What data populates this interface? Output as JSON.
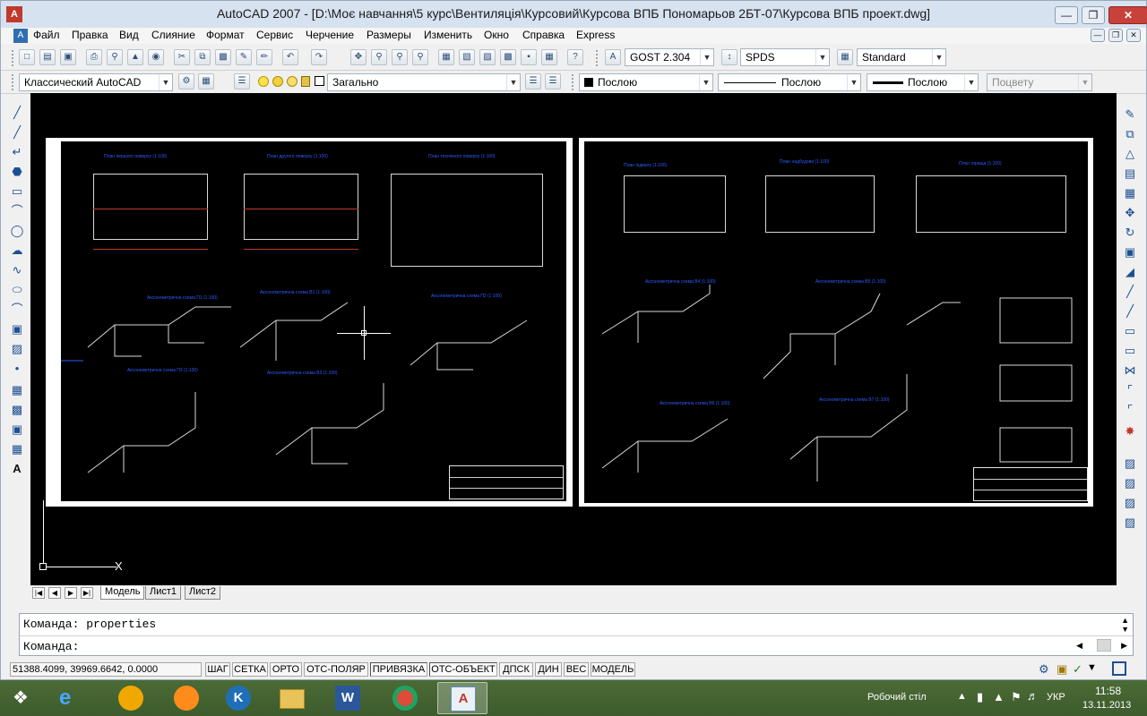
{
  "window": {
    "title": "AutoCAD 2007 - [D:\\Моє навчання\\5 курс\\Вентиляція\\Курсовий\\Курсова ВПБ Пономарьов 2БТ-07\\Курсова ВПБ проект.dwg]",
    "minimize_icon": "minimize-icon",
    "maximize_icon": "maximize-icon",
    "close_icon": "close-icon"
  },
  "menu": {
    "items": [
      "Файл",
      "Правка",
      "Вид",
      "Слияние",
      "Формат",
      "Сервис",
      "Черчение",
      "Размеры",
      "Изменить",
      "Окно",
      "Справка",
      "Express"
    ]
  },
  "toolbar_standard": {
    "text_style": "GOST 2.304",
    "dim_style": "SPDS",
    "table_style": "Standard"
  },
  "toolbar_layers": {
    "workspace": "Классический AutoCAD",
    "layer": "Загально",
    "color": "Послою",
    "linetype": "Послою",
    "lineweight": "Послою",
    "plot_style": "Поцвету"
  },
  "drawing": {
    "sheet1_titles": [
      "План першого поверху (1:100)",
      "План другого поверху (1:100)",
      "План технічного поверху (1:100)",
      "Аксонометрична схема П1 (1:100)",
      "Аксонометрична схема В1 (1:100)",
      "Аксонометрична схема П2 (1:100)",
      "Аксонометрична схема П3 (1:100)",
      "Аксонометрична схема В3 (1:100)"
    ],
    "sheet2_titles": [
      "План підвалу (1:100)",
      "План надбудови (1:100)",
      "План горища (1:100)",
      "Аксонометрична схема В4 (1:100)",
      "Аксонометрична схема В5 (1:100)",
      "Аксонометрична схема В6 (1:100)",
      "Аксонометрична схема В7 (1:100)"
    ],
    "ucs_x_label": "X"
  },
  "layout_tabs": [
    "Модель",
    "Лист1",
    "Лист2"
  ],
  "command": {
    "history": "Команда: properties",
    "prompt": "Команда:"
  },
  "status": {
    "coords": "51388.4099, 39969.6642, 0.0000",
    "buttons": [
      "ШАГ",
      "СЕТКА",
      "ОРТО",
      "ОТС-ПОЛЯР",
      "ПРИВЯЗКА",
      "ОТС-ОБЪЕКТ",
      "ДПСК",
      "ДИН",
      "ВЕС",
      "МОДЕЛЬ"
    ]
  },
  "taskbar": {
    "desktop_label": "Робочий стіл",
    "language": "УКР",
    "time": "11:58",
    "date": "13.11.2013"
  }
}
